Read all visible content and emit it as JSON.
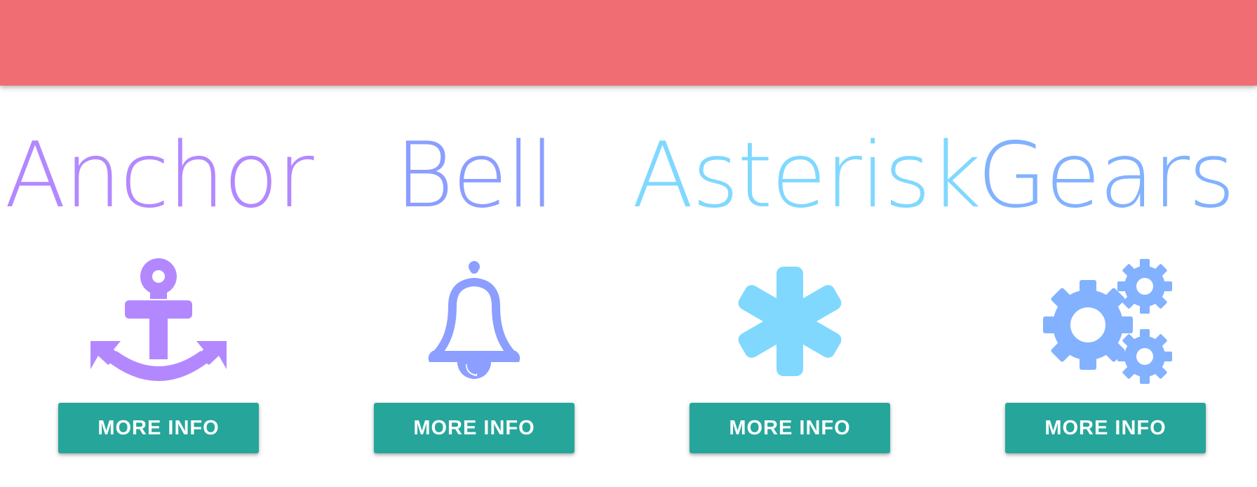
{
  "header": {
    "color": "#f06d73"
  },
  "cards": [
    {
      "title": "Anchor",
      "icon": "anchor-icon",
      "color": "#b388ff",
      "button_label": "MORE INFO"
    },
    {
      "title": "Bell",
      "icon": "bell-icon",
      "color": "#8c9eff",
      "button_label": "MORE INFO"
    },
    {
      "title": "Asterisk",
      "icon": "asterisk-icon",
      "color": "#80d8ff",
      "button_label": "MORE INFO"
    },
    {
      "title": "Gears",
      "icon": "gears-icon",
      "color": "#82b1ff",
      "button_label": "MORE INFO"
    }
  ],
  "button_color": "#26a69a"
}
